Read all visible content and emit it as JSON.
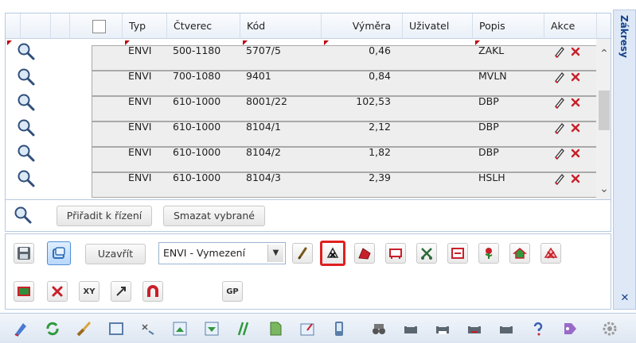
{
  "grid": {
    "columns": {
      "typ": "Typ",
      "ctverec": "Čtverec",
      "kod": "Kód",
      "vymera": "Výměra",
      "uzivatel": "Uživatel",
      "popis": "Popis",
      "akce": "Akce"
    },
    "rows": [
      {
        "typ": "ENVI",
        "ctverec": "500-1180",
        "kod": "5707/5",
        "vymera": "0,46",
        "uzivatel": "",
        "popis": "ZAKL"
      },
      {
        "typ": "ENVI",
        "ctverec": "700-1080",
        "kod": "9401",
        "vymera": "0,84",
        "uzivatel": "",
        "popis": "MVLN"
      },
      {
        "typ": "ENVI",
        "ctverec": "610-1000",
        "kod": "8001/22",
        "vymera": "102,53",
        "uzivatel": "",
        "popis": "DBP"
      },
      {
        "typ": "ENVI",
        "ctverec": "610-1000",
        "kod": "8104/1",
        "vymera": "2,12",
        "uzivatel": "",
        "popis": "DBP"
      },
      {
        "typ": "ENVI",
        "ctverec": "610-1000",
        "kod": "8104/2",
        "vymera": "1,82",
        "uzivatel": "",
        "popis": "DBP"
      },
      {
        "typ": "ENVI",
        "ctverec": "610-1000",
        "kod": "8104/3",
        "vymera": "2,39",
        "uzivatel": "",
        "popis": "HSLH"
      }
    ]
  },
  "actions": {
    "assign_label": "Přiřadit k řízení",
    "delete_selected_label": "Smazat vybrané"
  },
  "tools": {
    "close_label": "Uzavřít",
    "layer_select_value": "ENVI - Vymezení",
    "xy_label": "XY",
    "gp_label": "GP"
  },
  "side_panel": {
    "title": "Zákresy",
    "close_symbol": "✕"
  },
  "colors": {
    "accent_border": "#b7c9e2",
    "selected_tool_outline": "#e01f1f",
    "side_title": "#15428b"
  }
}
